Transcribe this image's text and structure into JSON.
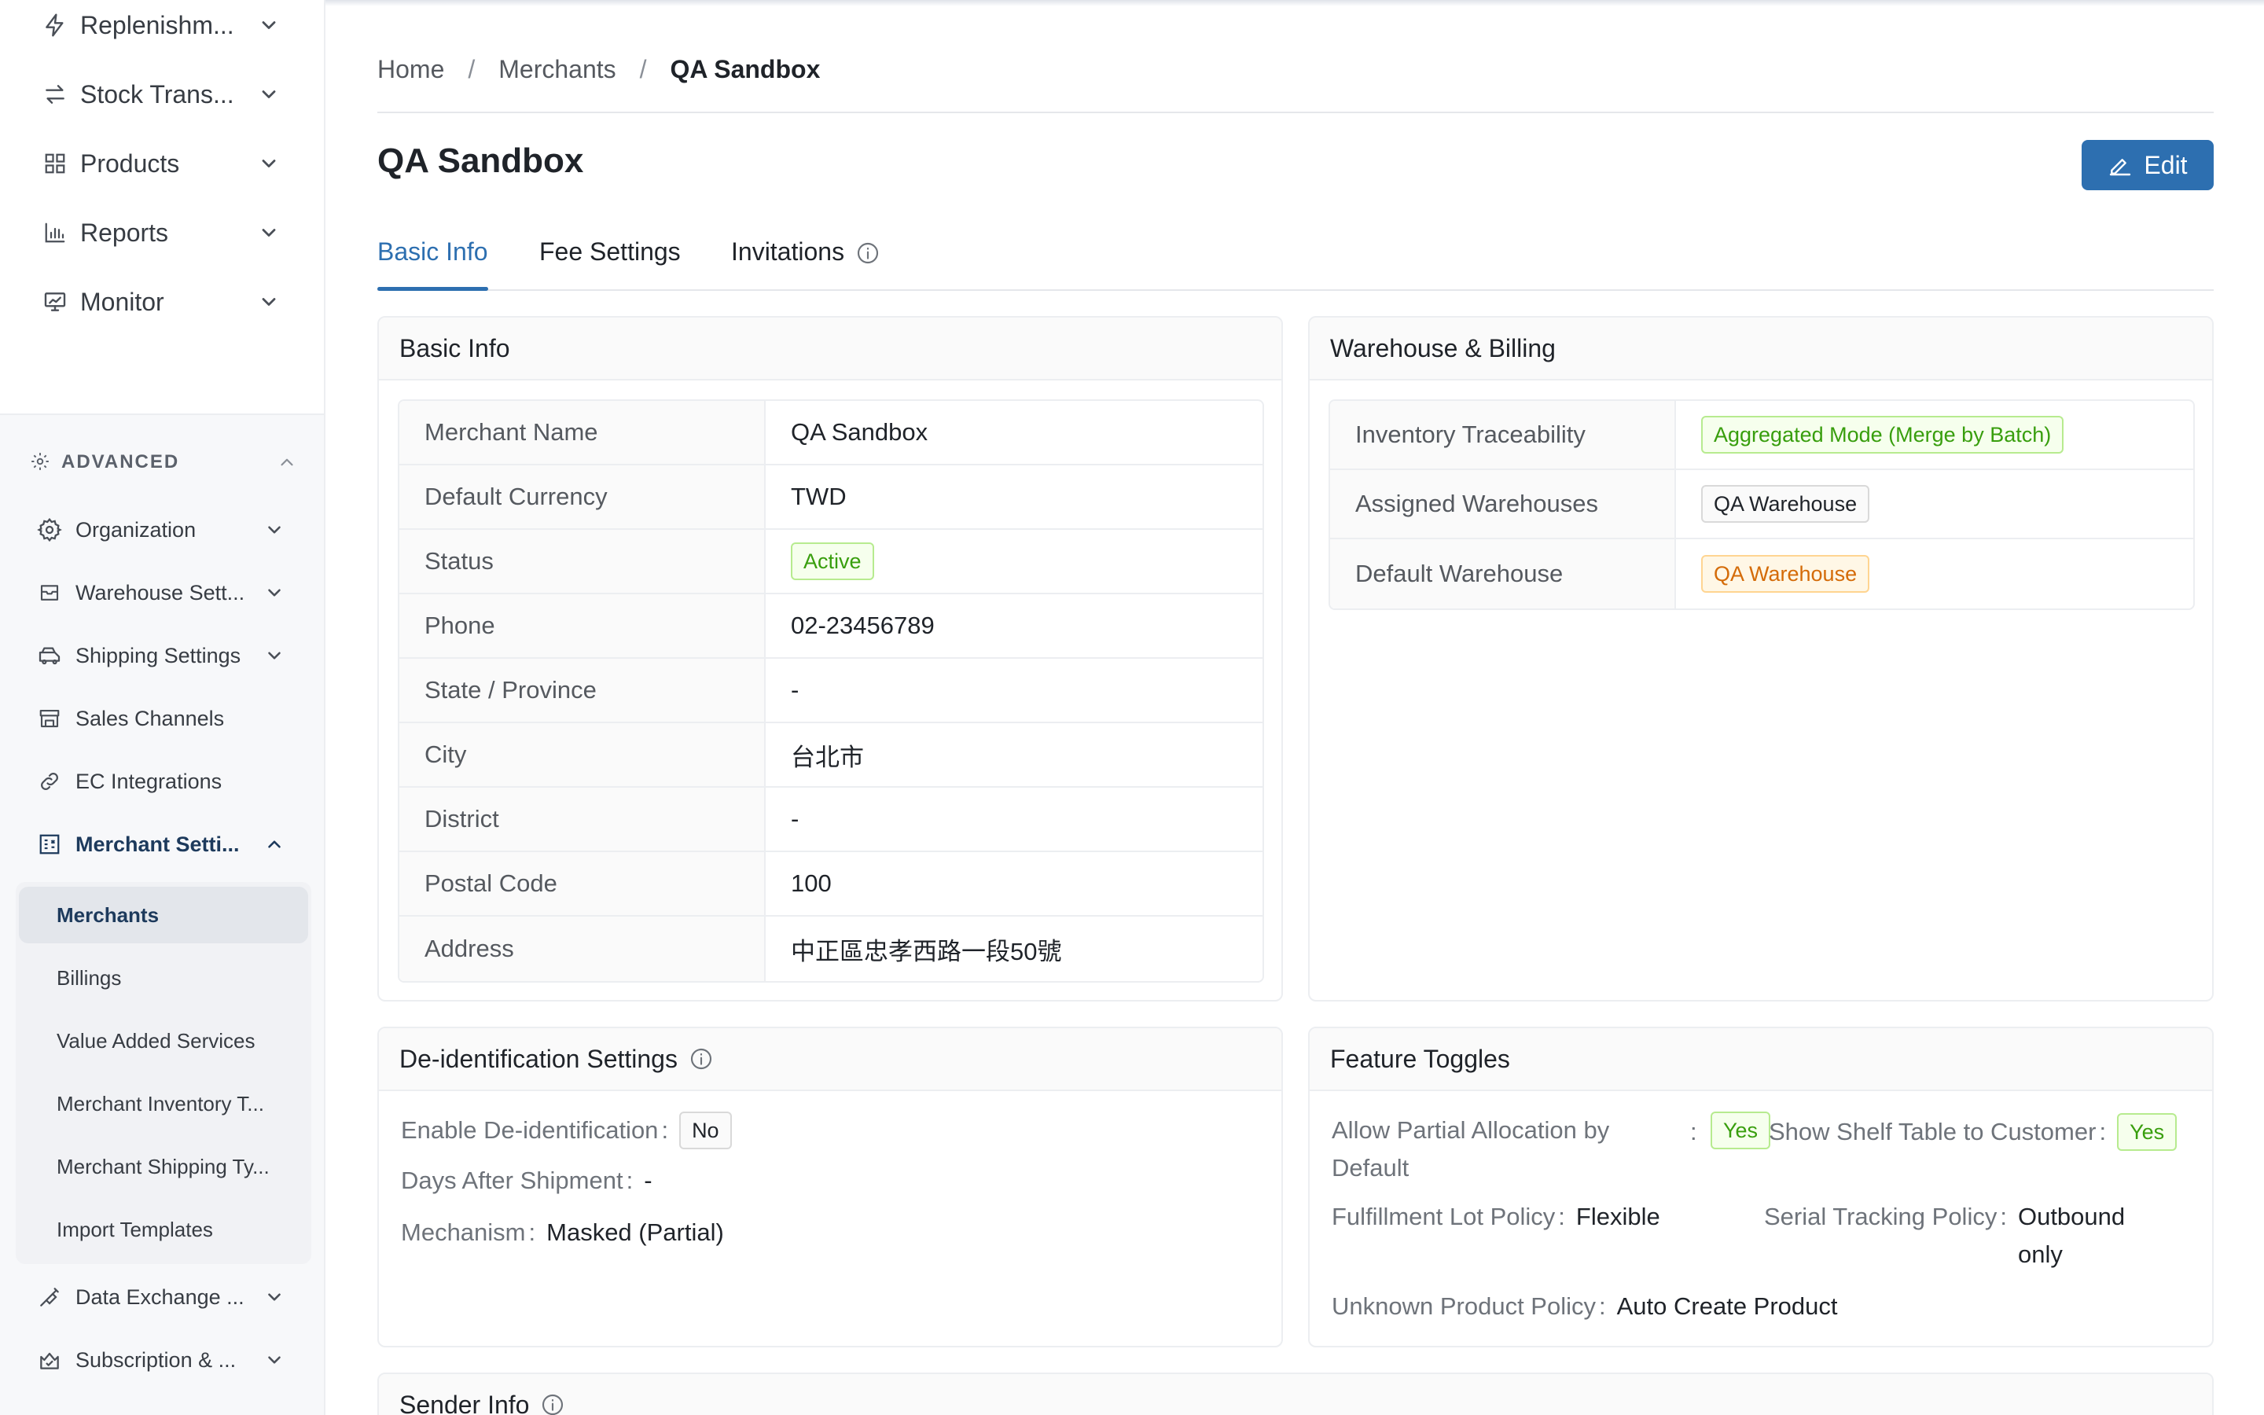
{
  "sidebar": {
    "top_items": [
      {
        "label": "Replenishm...",
        "icon": "bolt-icon"
      },
      {
        "label": "Stock Trans...",
        "icon": "transfer-icon"
      },
      {
        "label": "Products",
        "icon": "grid-icon"
      },
      {
        "label": "Reports",
        "icon": "bar-chart-icon"
      },
      {
        "label": "Monitor",
        "icon": "monitor-icon"
      }
    ],
    "advanced_label": "ADVANCED",
    "advanced_items": [
      {
        "label": "Organization",
        "icon": "gear-icon"
      },
      {
        "label": "Warehouse Sett...",
        "icon": "box-icon"
      },
      {
        "label": "Shipping Settings",
        "icon": "truck-icon"
      },
      {
        "label": "Sales Channels",
        "icon": "store-icon"
      },
      {
        "label": "EC Integrations",
        "icon": "link-icon"
      },
      {
        "label": "Merchant Setti...",
        "icon": "merchant-icon"
      }
    ],
    "merchant_sub_items": [
      "Merchants",
      "Billings",
      "Value Added Services",
      "Merchant Inventory T...",
      "Merchant Shipping Ty...",
      "Import Templates"
    ],
    "bottom_items": [
      {
        "label": "Data Exchange ...",
        "icon": "exchange-icon"
      },
      {
        "label": "Subscription & ...",
        "icon": "subscription-icon"
      }
    ]
  },
  "breadcrumb": {
    "home": "Home",
    "merchants": "Merchants",
    "current": "QA Sandbox",
    "separator": "/"
  },
  "page": {
    "title": "QA Sandbox",
    "edit_label": "Edit"
  },
  "tabs": {
    "basic_info": "Basic Info",
    "fee_settings": "Fee Settings",
    "invitations": "Invitations"
  },
  "basic_info": {
    "title": "Basic Info",
    "rows": [
      {
        "label": "Merchant Name",
        "value": "QA Sandbox"
      },
      {
        "label": "Default Currency",
        "value": "TWD"
      },
      {
        "label": "Status",
        "value": "Active"
      },
      {
        "label": "Phone",
        "value": "02-23456789"
      },
      {
        "label": "State / Province",
        "value": "-"
      },
      {
        "label": "City",
        "value": "台北市"
      },
      {
        "label": "District",
        "value": "-"
      },
      {
        "label": "Postal Code",
        "value": "100"
      },
      {
        "label": "Address",
        "value": "中正區忠孝西路一段50號"
      }
    ]
  },
  "warehouse_billing": {
    "title": "Warehouse & Billing",
    "rows": [
      {
        "label": "Inventory Traceability",
        "value": "Aggregated Mode (Merge by Batch)"
      },
      {
        "label": "Assigned Warehouses",
        "value": "QA Warehouse"
      },
      {
        "label": "Default Warehouse",
        "value": "QA Warehouse"
      }
    ]
  },
  "deidentification": {
    "title": "De-identification Settings",
    "enable_label": "Enable De-identification",
    "enable_value": "No",
    "days_label": "Days After Shipment",
    "days_value": "-",
    "mechanism_label": "Mechanism",
    "mechanism_value": "Masked (Partial)"
  },
  "feature_toggles": {
    "title": "Feature Toggles",
    "partial_label_line1": "Allow Partial Allocation by",
    "partial_label_line2": "Default",
    "partial_value": "Yes",
    "shelf_label": "Show Shelf Table to Customer",
    "shelf_value": "Yes",
    "lot_label": "Fulfillment Lot Policy",
    "lot_value": "Flexible",
    "serial_label": "Serial Tracking Policy",
    "serial_value_line1": "Outbound",
    "serial_value_line2": "only",
    "unknown_label": "Unknown Product Policy",
    "unknown_value": "Auto Create Product"
  },
  "sender_info": {
    "title": "Sender Info"
  },
  "colors": {
    "primary": "#2d6fb0",
    "success": "#389e0d",
    "warning": "#d46b08"
  }
}
